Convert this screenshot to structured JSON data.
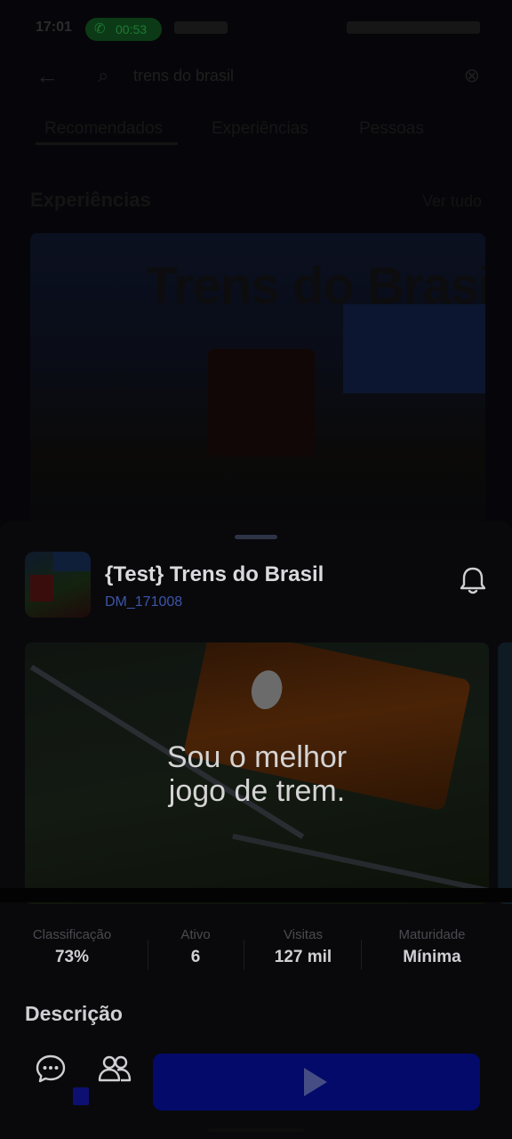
{
  "status_bar": {
    "time": "17:01",
    "call_duration": "00:53"
  },
  "background": {
    "search": {
      "query": "trens do brasil"
    },
    "tabs": [
      "Recomendados",
      "Experiências",
      "Pessoas"
    ],
    "section_title": "Experiências",
    "section_more": "Ver tudo",
    "hero_title": "Trens do Brasil"
  },
  "sheet": {
    "game": {
      "title": "{Test} Trens do Brasil",
      "creator": "DM_171008"
    },
    "media": {
      "caption_line1": "Sou o melhor",
      "caption_line2": "jogo de trem."
    },
    "stats": [
      {
        "label": "Classificação",
        "value": "73%"
      },
      {
        "label": "Ativo",
        "value": "6"
      },
      {
        "label": "Visitas",
        "value": "127 mil"
      },
      {
        "label": "Maturidade",
        "value": "Mínima"
      }
    ],
    "description_title": "Descrição"
  },
  "icons": {
    "bell": "bell-icon",
    "chat": "chat-icon",
    "friends": "friends-icon",
    "play": "play-icon"
  },
  "colors": {
    "play_button": "#030a6a",
    "creator_link": "#3c55a8",
    "call_pill": "#0c3a16"
  }
}
